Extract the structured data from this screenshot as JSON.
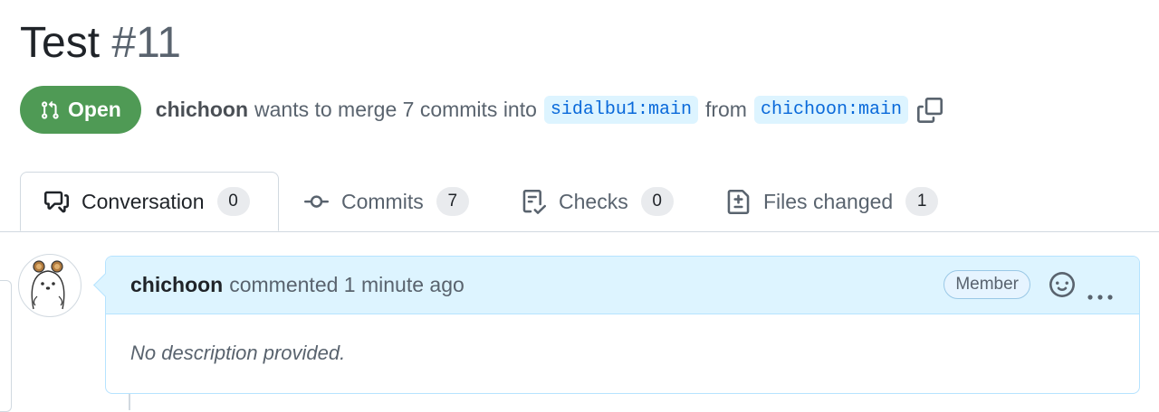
{
  "pr": {
    "title": "Test",
    "number": "#11"
  },
  "state": {
    "label": "Open",
    "color": "#4f9a55"
  },
  "meta": {
    "author": "chichoon",
    "text_before": "wants to merge 7 commits into",
    "base_branch": "sidalbu1:main",
    "text_from": "from",
    "head_branch": "chichoon:main",
    "copy_icon": "copy-icon"
  },
  "tabs": [
    {
      "label": "Conversation",
      "count": "0",
      "icon": "comment-discussion-icon"
    },
    {
      "label": "Commits",
      "count": "7",
      "icon": "git-commit-icon"
    },
    {
      "label": "Checks",
      "count": "0",
      "icon": "checklist-icon"
    },
    {
      "label": "Files changed",
      "count": "1",
      "icon": "file-diff-icon"
    }
  ],
  "comment": {
    "author": "chichoon",
    "action": "commented 1 minute ago",
    "role_badge": "Member",
    "body": "No description provided.",
    "react_icon": "smiley-icon",
    "more_icon": "kebab-horizontal-icon"
  }
}
